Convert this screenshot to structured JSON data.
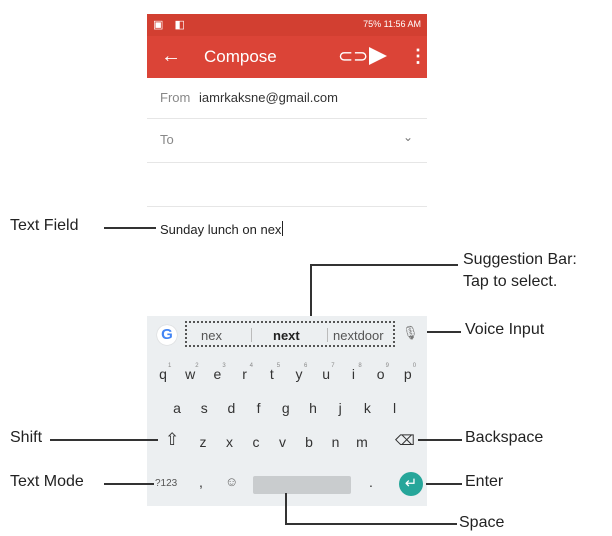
{
  "status_bar": {
    "left_icons": "▣ ◧",
    "right_text": "75%   11:56 AM"
  },
  "app_bar": {
    "back": "←",
    "title": "Compose",
    "attach": "⊂⊃",
    "more": "⋮"
  },
  "compose": {
    "from_label": "From",
    "from_value": "iamrkaksne@gmail.com",
    "to_label": "To",
    "to_chevron": "⌄",
    "body_text": "Sunday lunch on nex"
  },
  "keyboard": {
    "logo": "G",
    "suggestions": [
      "nex",
      "next",
      "nextdoor"
    ],
    "mic": "🎙",
    "row1": [
      "q",
      "w",
      "e",
      "r",
      "t",
      "y",
      "u",
      "i",
      "o",
      "p"
    ],
    "row1_sup": [
      "1",
      "2",
      "3",
      "4",
      "5",
      "6",
      "7",
      "8",
      "9",
      "0"
    ],
    "row2": [
      "a",
      "s",
      "d",
      "f",
      "g",
      "h",
      "j",
      "k",
      "l"
    ],
    "row3": [
      "z",
      "x",
      "c",
      "v",
      "b",
      "n",
      "m"
    ],
    "shift": "⇧",
    "backspace": "⌫",
    "symbols": "?123",
    "comma": ",",
    "emoji": "☺",
    "period": ".",
    "enter": "↵"
  },
  "callouts": {
    "text_field": "Text Field",
    "suggestion_bar_1": "Suggestion Bar:",
    "suggestion_bar_2": "Tap to select.",
    "voice_input": "Voice Input",
    "shift": "Shift",
    "backspace": "Backspace",
    "text_mode": "Text Mode",
    "enter": "Enter",
    "space": "Space"
  }
}
